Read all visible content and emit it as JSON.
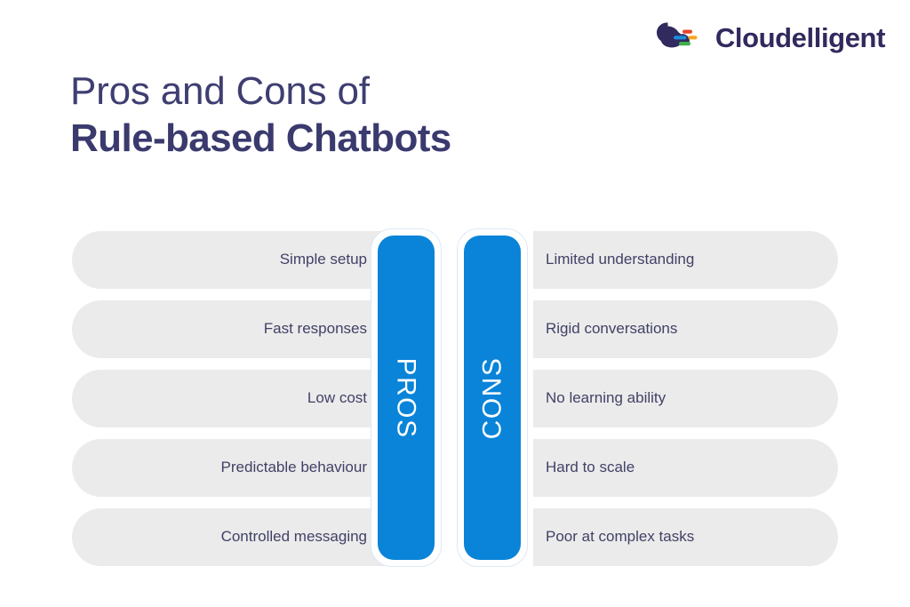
{
  "brand": {
    "name": "Cloudelligent",
    "logo_icon": "cloud-logo-icon",
    "wordmark_color": "#312a5e",
    "cloud_color": "#312a5e",
    "bar_colors": [
      "#e8452c",
      "#1b8ddb",
      "#f5a623",
      "#3fae4a"
    ]
  },
  "title": {
    "line1": "Pros and Cons of",
    "line2": "Rule-based Chatbots",
    "color": "#3a3a6e"
  },
  "compare": {
    "pros_label": "PROS",
    "cons_label": "CONS",
    "accent_color": "#0a84d8",
    "pill_color": "#ebebeb",
    "text_color": "#414167",
    "rows": [
      {
        "pro": "Simple setup",
        "con": "Limited understanding"
      },
      {
        "pro": "Fast responses",
        "con": "Rigid conversations"
      },
      {
        "pro": "Low cost",
        "con": "No learning ability"
      },
      {
        "pro": "Predictable behaviour",
        "con": "Hard to scale"
      },
      {
        "pro": "Controlled messaging",
        "con": "Poor at complex tasks"
      }
    ]
  }
}
